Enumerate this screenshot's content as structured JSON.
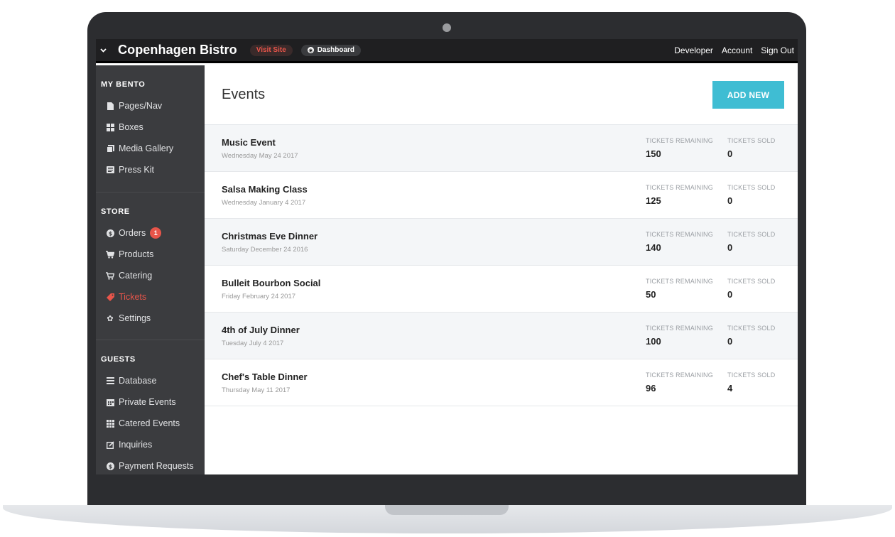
{
  "topbar": {
    "menu_icon": "chevron-down-icon",
    "brand": "Copenhagen Bistro",
    "visit_site": "Visit Site",
    "dashboard": "Dashboard",
    "links": [
      "Developer",
      "Account",
      "Sign Out"
    ]
  },
  "sidebar": {
    "sections": [
      {
        "heading": "MY BENTO",
        "items": [
          {
            "label": "Pages/Nav",
            "icon": "document-icon"
          },
          {
            "label": "Boxes",
            "icon": "grid-icon"
          },
          {
            "label": "Media Gallery",
            "icon": "gallery-icon"
          },
          {
            "label": "Press Kit",
            "icon": "newspaper-icon"
          }
        ]
      },
      {
        "heading": "STORE",
        "items": [
          {
            "label": "Orders",
            "icon": "dollar-icon",
            "badge": "1"
          },
          {
            "label": "Products",
            "icon": "cart-icon"
          },
          {
            "label": "Catering",
            "icon": "cart-icon"
          },
          {
            "label": "Tickets",
            "icon": "tag-icon",
            "active": true
          },
          {
            "label": "Settings",
            "icon": "gear-icon"
          }
        ]
      },
      {
        "heading": "GUESTS",
        "items": [
          {
            "label": "Database",
            "icon": "list-icon"
          },
          {
            "label": "Private Events",
            "icon": "calendar-icon"
          },
          {
            "label": "Catered Events",
            "icon": "grid-icon"
          },
          {
            "label": "Inquiries",
            "icon": "edit-icon"
          },
          {
            "label": "Payment Requests",
            "icon": "dollar-icon"
          }
        ]
      }
    ]
  },
  "main": {
    "title": "Events",
    "add_new": "ADD NEW",
    "tickets_remaining_label": "TICKETS REMAINING",
    "tickets_sold_label": "TICKETS SOLD",
    "events": [
      {
        "name": "Music Event",
        "date": "Wednesday May 24 2017",
        "remaining": "150",
        "sold": "0"
      },
      {
        "name": "Salsa Making Class",
        "date": "Wednesday January 4 2017",
        "remaining": "125",
        "sold": "0"
      },
      {
        "name": "Christmas Eve Dinner",
        "date": "Saturday December 24 2016",
        "remaining": "140",
        "sold": "0"
      },
      {
        "name": "Bulleit Bourbon Social",
        "date": "Friday February 24 2017",
        "remaining": "50",
        "sold": "0"
      },
      {
        "name": "4th of July Dinner",
        "date": "Tuesday July 4 2017",
        "remaining": "100",
        "sold": "0"
      },
      {
        "name": "Chef's Table Dinner",
        "date": "Thursday May 11 2017",
        "remaining": "96",
        "sold": "4"
      }
    ]
  },
  "colors": {
    "accent": "#e8554a",
    "add_button": "#3fbdd3",
    "sidebar": "#3b3c3f",
    "topbar": "#1f1f21"
  }
}
